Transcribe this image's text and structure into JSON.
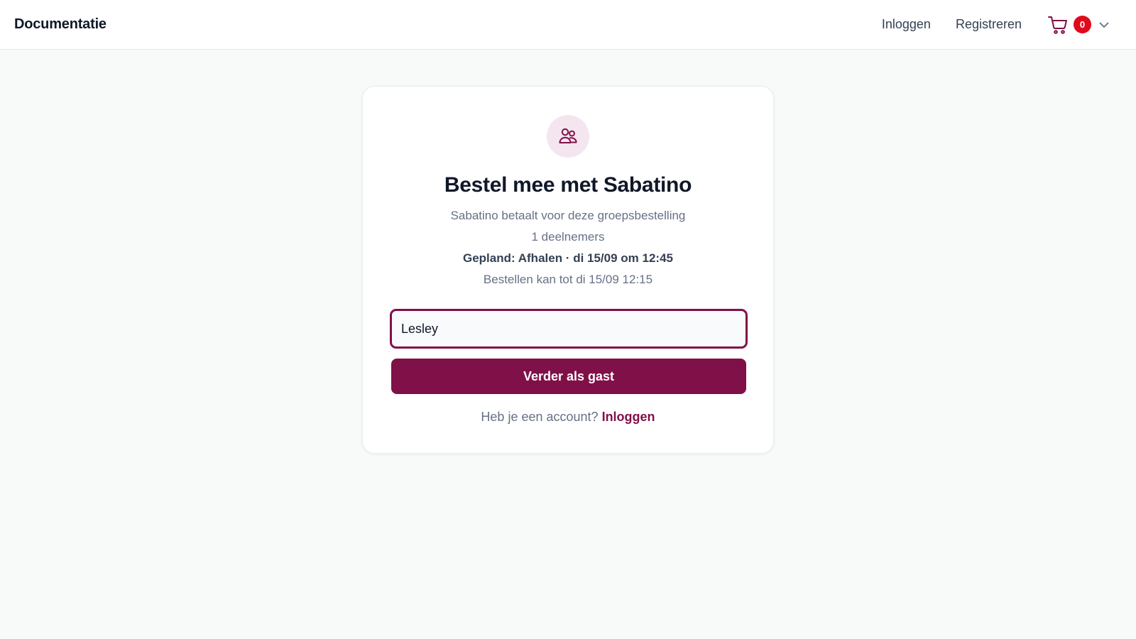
{
  "header": {
    "brand": "Documentatie",
    "login_label": "Inloggen",
    "register_label": "Registreren",
    "cart_count": "0",
    "cart_icon": "shopping-cart-icon",
    "chevron_icon": "chevron-down-icon"
  },
  "card": {
    "icon": "users-icon",
    "title": "Bestel mee met Sabatino",
    "payer_text": "Sabatino betaalt voor deze groepsbestelling",
    "participants_text": "1 deelnemers",
    "planned_text": "Gepland: Afhalen · di 15/09 om 12:45",
    "deadline_text": "Bestellen kan tot di 15/09 12:15",
    "name_input_value": "Lesley",
    "guest_button_label": "Verder als gast",
    "account_prompt": "Heb je een account?",
    "account_login_label": "Inloggen"
  },
  "colors": {
    "accent": "#801048",
    "badge": "#e00a1c",
    "background": "#f8f9f9",
    "avatar_bg": "#f4e6ee"
  }
}
